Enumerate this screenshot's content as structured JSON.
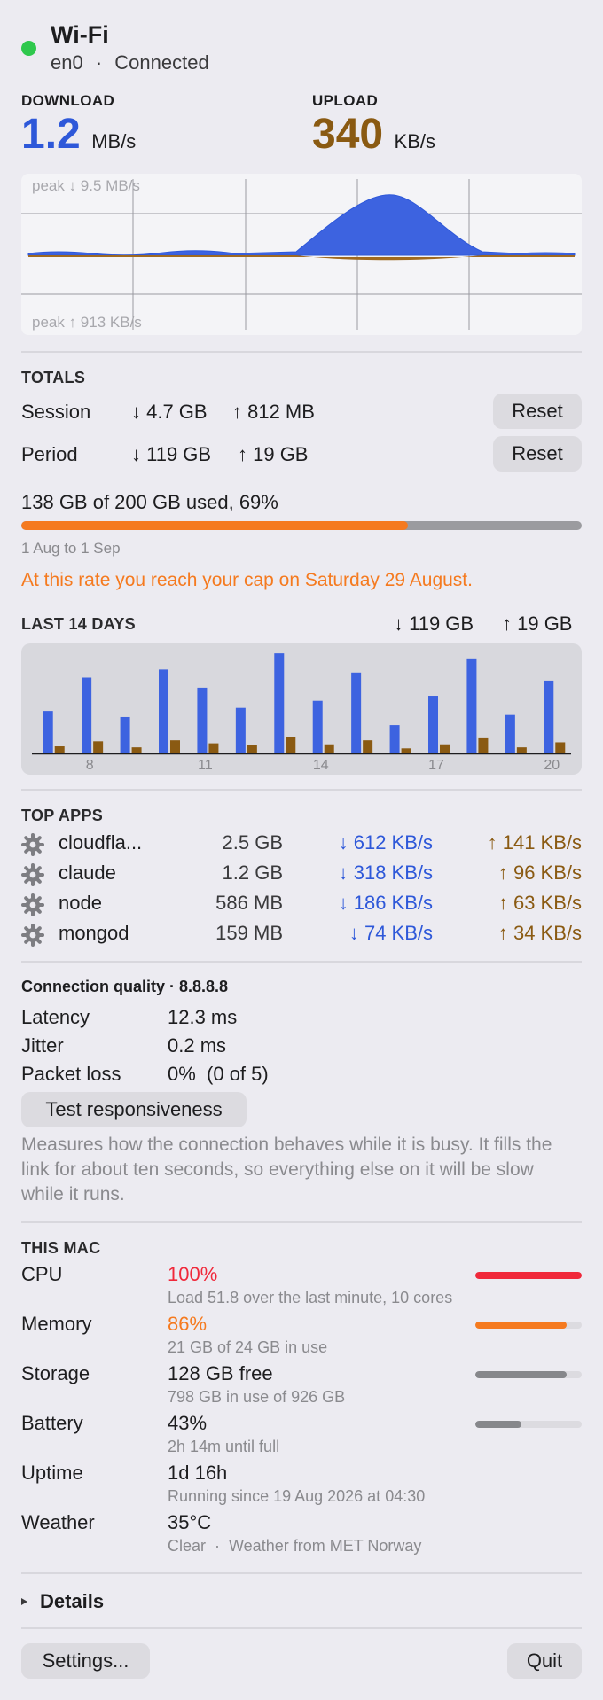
{
  "header": {
    "title": "Wi-Fi",
    "status_color": "#2fc84d",
    "interface": "en0",
    "separator": "·",
    "status": "Connected"
  },
  "throughput": {
    "download_label": "DOWNLOAD",
    "download_value": "1.2",
    "download_unit": "MB/s",
    "upload_label": "UPLOAD",
    "upload_value": "340",
    "upload_unit": "KB/s",
    "download_color": "#2e58d9",
    "upload_color": "#8a5a12"
  },
  "live_graph": {
    "peak_down": "peak ↓ 9.5 MB/s",
    "peak_up": "peak ↑ 913 KB/s"
  },
  "totals": {
    "title": "TOTALS",
    "rows": [
      {
        "label": "Session",
        "down": "↓ 4.7 GB",
        "up": "↑ 812 MB",
        "button": "Reset"
      },
      {
        "label": "Period",
        "down": "↓ 119 GB",
        "up": "↑ 19 GB",
        "button": "Reset"
      }
    ],
    "usage_text": "138 GB of 200 GB used, 69%",
    "usage_fraction": 0.69,
    "usage_color": "#f57a1f",
    "period_text": "1 Aug to 1 Sep",
    "warning": "At this rate you reach your cap on Saturday 29 August.",
    "warning_color": "#f57a1f"
  },
  "last14": {
    "title": "LAST 14 DAYS",
    "down_total": "↓ 119 GB",
    "up_total": "↑ 19 GB"
  },
  "chart_data": {
    "type": "bar",
    "title": "LAST 14 DAYS",
    "categories": [
      "7",
      "8",
      "9",
      "10",
      "11",
      "12",
      "13",
      "14",
      "15",
      "16",
      "17",
      "18",
      "19",
      "20"
    ],
    "tick_labels": [
      "8",
      "11",
      "14",
      "17",
      "20"
    ],
    "series": [
      {
        "name": "↓",
        "color": "#3d63e0",
        "values": [
          42,
          75,
          36,
          83,
          65,
          45,
          99,
          52,
          80,
          28,
          57,
          94,
          38,
          72
        ]
      },
      {
        "name": "↑",
        "color": "#8a5a12",
        "values": [
          7,
          12,
          6,
          13,
          10,
          8,
          16,
          9,
          13,
          5,
          9,
          15,
          6,
          11
        ]
      }
    ],
    "ylim": [
      0,
      100
    ],
    "grid": false
  },
  "top_apps": {
    "title": "TOP APPS",
    "apps": [
      {
        "name": "cloudfla...",
        "total": "2.5 GB",
        "down": "↓ 612 KB/s",
        "up": "↑ 141 KB/s"
      },
      {
        "name": "claude",
        "total": "1.2 GB",
        "down": "↓ 318 KB/s",
        "up": "↑ 96 KB/s"
      },
      {
        "name": "node",
        "total": "586 MB",
        "down": "↓ 186 KB/s",
        "up": "↑ 63 KB/s"
      },
      {
        "name": "mongod",
        "total": "159 MB",
        "down": "↓ 74 KB/s",
        "up": "↑ 34 KB/s"
      }
    ]
  },
  "quality": {
    "title": "Connection quality · 8.8.8.8",
    "rows": [
      {
        "label": "Latency",
        "value": "12.3 ms"
      },
      {
        "label": "Jitter",
        "value": "0.2 ms"
      },
      {
        "label": "Packet loss",
        "value": "0%  (0 of 5)"
      }
    ],
    "button": "Test responsiveness",
    "note": "Measures how the connection behaves while it is busy. It fills the link for about ten seconds, so everything else on it will be slow while it runs."
  },
  "this_mac": {
    "title": "THIS MAC",
    "rows": [
      {
        "label": "CPU",
        "value": "100%",
        "sub": "Load 51.8 over the last minute, 10 cores",
        "level": 1.0,
        "color": "#f0283a"
      },
      {
        "label": "Memory",
        "value": "86%",
        "sub": "21 GB of 24 GB in use",
        "level": 0.86,
        "color": "#f57a1f"
      },
      {
        "label": "Storage",
        "value": "128 GB free",
        "sub": "798 GB in use of 926 GB",
        "level": 0.86,
        "color": "#86878b"
      },
      {
        "label": "Battery",
        "value": "43%",
        "sub": "2h 14m until full",
        "level": 0.43,
        "color": "#86878b"
      },
      {
        "label": "Uptime",
        "value": "1d 16h",
        "sub": "Running since 19 Aug 2026 at 04:30"
      },
      {
        "label": "Weather",
        "value": "35°C",
        "sub": "Clear  ·  Weather from MET Norway"
      }
    ]
  },
  "details": {
    "label": "Details",
    "icon": "disclosure-triangle-icon"
  },
  "footer": {
    "settings": "Settings...",
    "quit": "Quit"
  }
}
